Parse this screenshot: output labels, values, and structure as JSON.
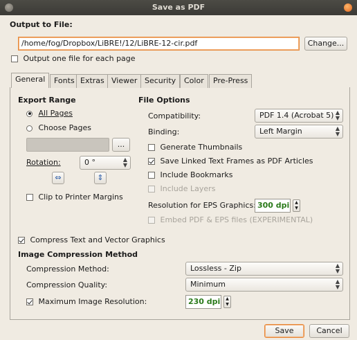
{
  "window": {
    "title": "Save as PDF"
  },
  "output": {
    "heading": "Output to File:",
    "path_value": "/home/fog/Dropbox/LiBRE!/12/LiBRE-12-cir.pdf",
    "change_button": "Change...",
    "one_file_per_page": {
      "label": "Output one file for each page",
      "checked": false
    }
  },
  "tabs": [
    {
      "label": "General",
      "active": true
    },
    {
      "label": "Fonts"
    },
    {
      "label": "Extras"
    },
    {
      "label": "Viewer"
    },
    {
      "label": "Security"
    },
    {
      "label": "Color"
    },
    {
      "label": "Pre-Press"
    }
  ],
  "export_range": {
    "heading": "Export Range",
    "all_pages": {
      "label": "All Pages",
      "selected": true
    },
    "choose_pages": {
      "label": "Choose Pages",
      "selected": false
    },
    "pages_field_value": "",
    "browse_button": "...",
    "rotation_label": "Rotation:",
    "rotation_value": "0 °",
    "clip_margins": {
      "label": "Clip to Printer Margins",
      "checked": false
    }
  },
  "file_options": {
    "heading": "File Options",
    "compatibility_label": "Compatibility:",
    "compatibility_value": "PDF 1.4 (Acrobat 5)",
    "binding_label": "Binding:",
    "binding_value": "Left Margin",
    "generate_thumbnails": {
      "label": "Generate Thumbnails",
      "checked": false
    },
    "save_linked_frames": {
      "label": "Save Linked Text Frames as PDF Articles",
      "checked": true
    },
    "include_bookmarks": {
      "label": "Include Bookmarks",
      "checked": false
    },
    "include_layers": {
      "label": "Include Layers",
      "checked": false,
      "disabled": true
    },
    "eps_resolution_label": "Resolution for EPS Graphics:",
    "eps_resolution_value": "300 dpi",
    "embed_pdf_eps": {
      "label": "Embed PDF & EPS files (EXPERIMENTAL)",
      "checked": false,
      "disabled": true
    }
  },
  "compression": {
    "compress_text": {
      "label": "Compress Text and Vector Graphics",
      "checked": true
    },
    "heading": "Image Compression Method",
    "method_label": "Compression Method:",
    "method_value": "Lossless - Zip",
    "quality_label": "Compression Quality:",
    "quality_value": "Minimum",
    "max_resolution": {
      "label": "Maximum Image Resolution:",
      "checked": true
    },
    "max_resolution_value": "230 dpi"
  },
  "footer": {
    "save_button": "Save",
    "cancel_button": "Cancel"
  },
  "colors": {
    "focus_border": "#e88a3c",
    "spin_value": "#2a7a1a",
    "close_button": "#e5661d"
  }
}
